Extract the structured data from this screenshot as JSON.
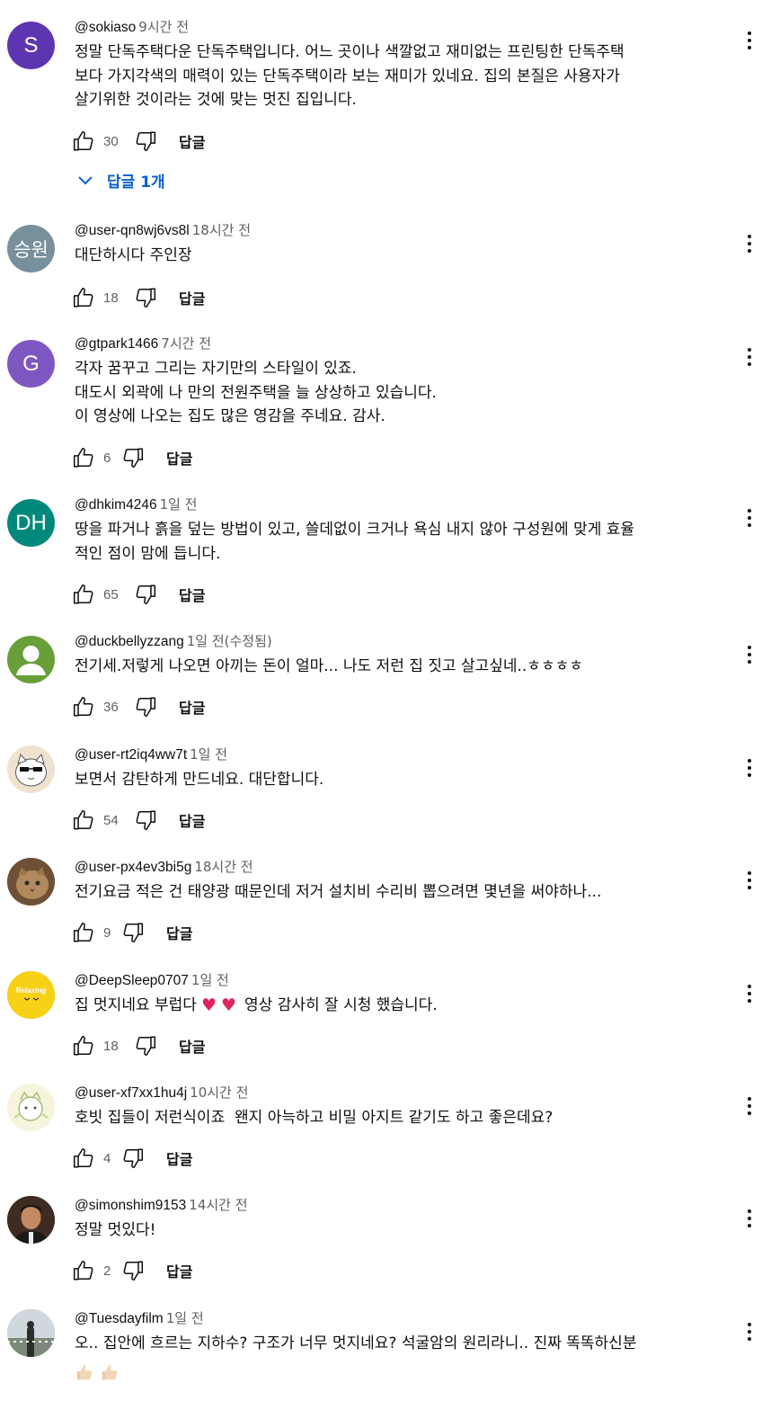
{
  "ui": {
    "reply_label": "답글",
    "accent": "#065fd4"
  },
  "comments": [
    {
      "handle": "@sokiaso",
      "time": "9시간 전",
      "lines": [
        "정말 단독주택다운 단독주택입니다. 어느 곳이나 색깔없고 재미없는 프린팅한 단독주택",
        "보다 가지각색의 매력이 있는 단독주택이라 보는 재미가 있네요. 집의 본질은 사용자가",
        "살기위한 것이라는 것에 맞는 멋진 집입니다."
      ],
      "likes": "30",
      "avatar": {
        "type": "letter",
        "letter": "S",
        "color": "#5e35b1"
      },
      "replies_label": "답글 1개"
    },
    {
      "handle": "@user-qn8wj6vs8l",
      "time": "18시간 전",
      "lines": [
        "대단하시다 주인장"
      ],
      "likes": "18",
      "avatar": {
        "type": "letter",
        "letter": "승원",
        "color": "#78909c"
      }
    },
    {
      "handle": "@gtpark1466",
      "time": "7시간 전",
      "lines": [
        "각자 꿈꾸고 그리는 자기만의 스타일이 있죠.",
        "대도시 외곽에 나 만의 전원주택을 늘 상상하고 있습니다.",
        "이 영상에 나오는 집도 많은 영감을 주네요. 감사."
      ],
      "likes": "6",
      "avatar": {
        "type": "letter",
        "letter": "G",
        "color": "#7e57c2"
      }
    },
    {
      "handle": "@dhkim4246",
      "time": "1일 전",
      "lines": [
        "땅을 파거나 흙을 덮는 방법이 있고, 쓸데없이 크거나 욕심 내지 않아 구성원에 맞게 효율",
        "적인 점이 맘에 듭니다."
      ],
      "likes": "65",
      "avatar": {
        "type": "letter",
        "letter": "DH",
        "color": "#00897b"
      }
    },
    {
      "handle": "@duckbellyzzang",
      "time": "1일 전(수정됨)",
      "lines": [
        "전기세.저렇게 나오면 아끼는 돈이 얼마... 나도 저런 집 짓고 살고싶네..ㅎㅎㅎㅎ"
      ],
      "likes": "36",
      "avatar": {
        "type": "person",
        "color": "#689f38"
      }
    },
    {
      "handle": "@user-rt2iq4ww7t",
      "time": "1일 전",
      "lines": [
        "보면서 감탄하게 만드네요. 대단합니다."
      ],
      "likes": "54",
      "avatar": {
        "type": "cat",
        "color": "#efe3d0"
      }
    },
    {
      "handle": "@user-px4ev3bi5g",
      "time": "18시간 전",
      "lines": [
        "전기요금 적은 건 태양광 때문인데 저거 설치비 수리비 뽑으려면 몇년을 써야하나..."
      ],
      "likes": "9",
      "avatar": {
        "type": "photo-cat",
        "color": "#8d6e4c"
      }
    },
    {
      "handle": "@DeepSleep0707",
      "time": "1일 전",
      "lines": [
        "집 멋지네요 부럽다"
      ],
      "suffix": "영상 감사히 잘 시청 했습니다.",
      "heart": "♥",
      "likes": "18",
      "avatar": {
        "type": "relaxing",
        "color": "#f7d116",
        "logo_text": "Relaxing"
      }
    },
    {
      "handle": "@user-xf7xx1hu4j",
      "time": "10시간 전",
      "lines": [
        "호빗 집들이 저런식이죠  왠지 아늑하고 비밀 아지트 같기도 하고 좋은데요?"
      ],
      "likes": "4",
      "avatar": {
        "type": "drawing",
        "color": "#f3f0c8"
      }
    },
    {
      "handle": "@simonshim9153",
      "time": "14시간 전",
      "lines": [
        "정말 멋있다!"
      ],
      "likes": "2",
      "avatar": {
        "type": "photo-man",
        "color": "#5d4037"
      }
    },
    {
      "handle": "@Tuesdayfilm",
      "time": "1일 전",
      "lines": [
        "오.. 집안에 흐르는 지하수? 구조가 너무 멋지네요? 석굴암의 원리라니.. 진짜 똑똑하신분"
      ],
      "emoji": "thumbs-up-emoji",
      "likes": "",
      "avatar": {
        "type": "photo-statue",
        "color": "#9e9e9e"
      }
    }
  ]
}
